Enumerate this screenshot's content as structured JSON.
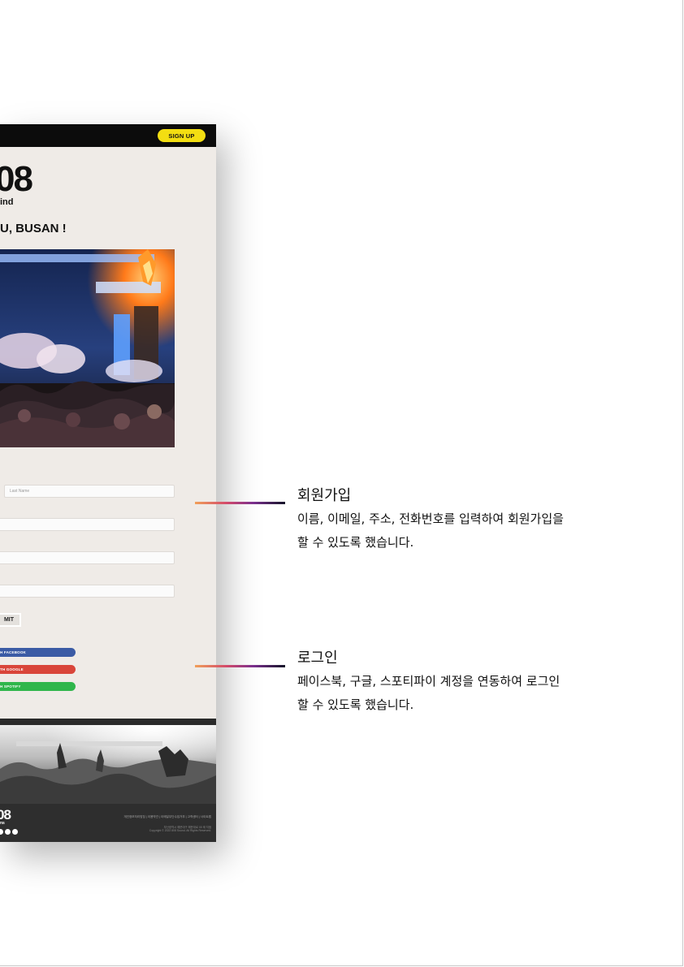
{
  "mockup": {
    "signup_label": "SIGN UP",
    "logo_main": "08",
    "logo_sub": "ind",
    "headline": "U, BUSAN !",
    "form": {
      "last_name_placeholder": "Last Name",
      "submit_label": "MIT"
    },
    "social": {
      "facebook_label": "H FACEBOOK",
      "google_label": "TH GOOGLE",
      "spotify_label": "H SPOTIFY",
      "facebook_color": "#3b5ba5",
      "google_color": "#d9453a",
      "spotify_color": "#2fb64b"
    },
    "footer": {
      "logo_main": "08",
      "logo_sub": "ns",
      "links": "개인정보처리방침 | 이용약관 | 이메일무단수집거부 | 고객센터 | 사이트맵",
      "address": "부산광역시 해운대구 해운대로 00 제 지점",
      "copyright": "Copyright © 2022 808 Sound. All Rights Reserved."
    },
    "accent_yellow": "#f3de12"
  },
  "annotations": [
    {
      "title": "회원가입",
      "description_line1": "이름, 이메일, 주소, 전화번호를 입력하여 회원가입을",
      "description_line2": "할 수 있도록 했습니다."
    },
    {
      "title": "로그인",
      "description_line1": "페이스북, 구글, 스포티파이 계정을 연동하여 로그인",
      "description_line2": "할 수 있도록 했습니다."
    }
  ]
}
